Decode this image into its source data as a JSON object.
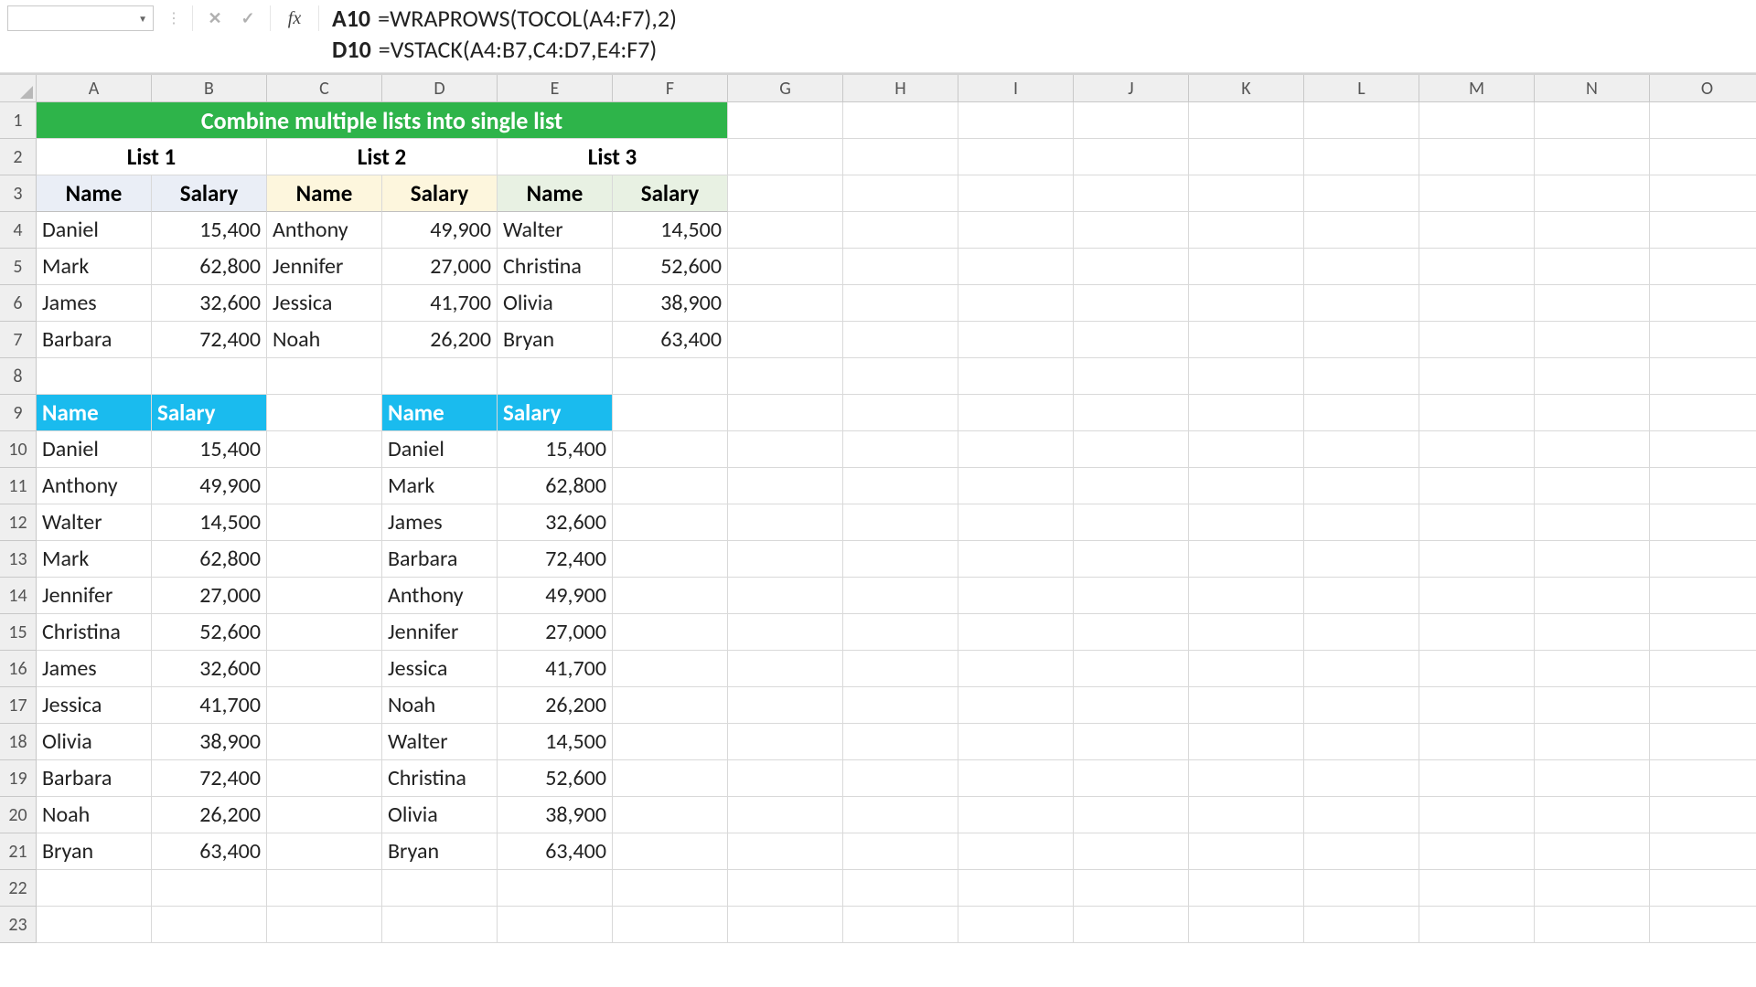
{
  "nameBox": "",
  "formulas": [
    {
      "ref": "A10",
      "expr": "=WRAPROWS(TOCOL(A4:F7),2)"
    },
    {
      "ref": "D10",
      "expr": "=VSTACK(A4:B7,C4:D7,E4:F7)"
    }
  ],
  "columns": [
    "A",
    "B",
    "C",
    "D",
    "E",
    "F",
    "G",
    "H",
    "I",
    "J",
    "K",
    "L",
    "M",
    "N",
    "O"
  ],
  "title": "Combine multiple lists into single list",
  "listLabels": [
    "List 1",
    "List 2",
    "List 3"
  ],
  "colHeaders": {
    "name": "Name",
    "salary": "Salary"
  },
  "source": {
    "list1": [
      {
        "name": "Daniel",
        "salary": "15,400"
      },
      {
        "name": "Mark",
        "salary": "62,800"
      },
      {
        "name": "James",
        "salary": "32,600"
      },
      {
        "name": "Barbara",
        "salary": "72,400"
      }
    ],
    "list2": [
      {
        "name": "Anthony",
        "salary": "49,900"
      },
      {
        "name": "Jennifer",
        "salary": "27,000"
      },
      {
        "name": "Jessica",
        "salary": "41,700"
      },
      {
        "name": "Noah",
        "salary": "26,200"
      }
    ],
    "list3": [
      {
        "name": "Walter",
        "salary": "14,500"
      },
      {
        "name": "Christina",
        "salary": "52,600"
      },
      {
        "name": "Olivia",
        "salary": "38,900"
      },
      {
        "name": "Bryan",
        "salary": "63,400"
      }
    ]
  },
  "resultA": [
    {
      "name": "Daniel",
      "salary": "15,400"
    },
    {
      "name": "Anthony",
      "salary": "49,900"
    },
    {
      "name": "Walter",
      "salary": "14,500"
    },
    {
      "name": "Mark",
      "salary": "62,800"
    },
    {
      "name": "Jennifer",
      "salary": "27,000"
    },
    {
      "name": "Christina",
      "salary": "52,600"
    },
    {
      "name": "James",
      "salary": "32,600"
    },
    {
      "name": "Jessica",
      "salary": "41,700"
    },
    {
      "name": "Olivia",
      "salary": "38,900"
    },
    {
      "name": "Barbara",
      "salary": "72,400"
    },
    {
      "name": "Noah",
      "salary": "26,200"
    },
    {
      "name": "Bryan",
      "salary": "63,400"
    }
  ],
  "resultD": [
    {
      "name": "Daniel",
      "salary": "15,400"
    },
    {
      "name": "Mark",
      "salary": "62,800"
    },
    {
      "name": "James",
      "salary": "32,600"
    },
    {
      "name": "Barbara",
      "salary": "72,400"
    },
    {
      "name": "Anthony",
      "salary": "49,900"
    },
    {
      "name": "Jennifer",
      "salary": "27,000"
    },
    {
      "name": "Jessica",
      "salary": "41,700"
    },
    {
      "name": "Noah",
      "salary": "26,200"
    },
    {
      "name": "Walter",
      "salary": "14,500"
    },
    {
      "name": "Christina",
      "salary": "52,600"
    },
    {
      "name": "Olivia",
      "salary": "38,900"
    },
    {
      "name": "Bryan",
      "salary": "63,400"
    }
  ],
  "rowCount": 23
}
